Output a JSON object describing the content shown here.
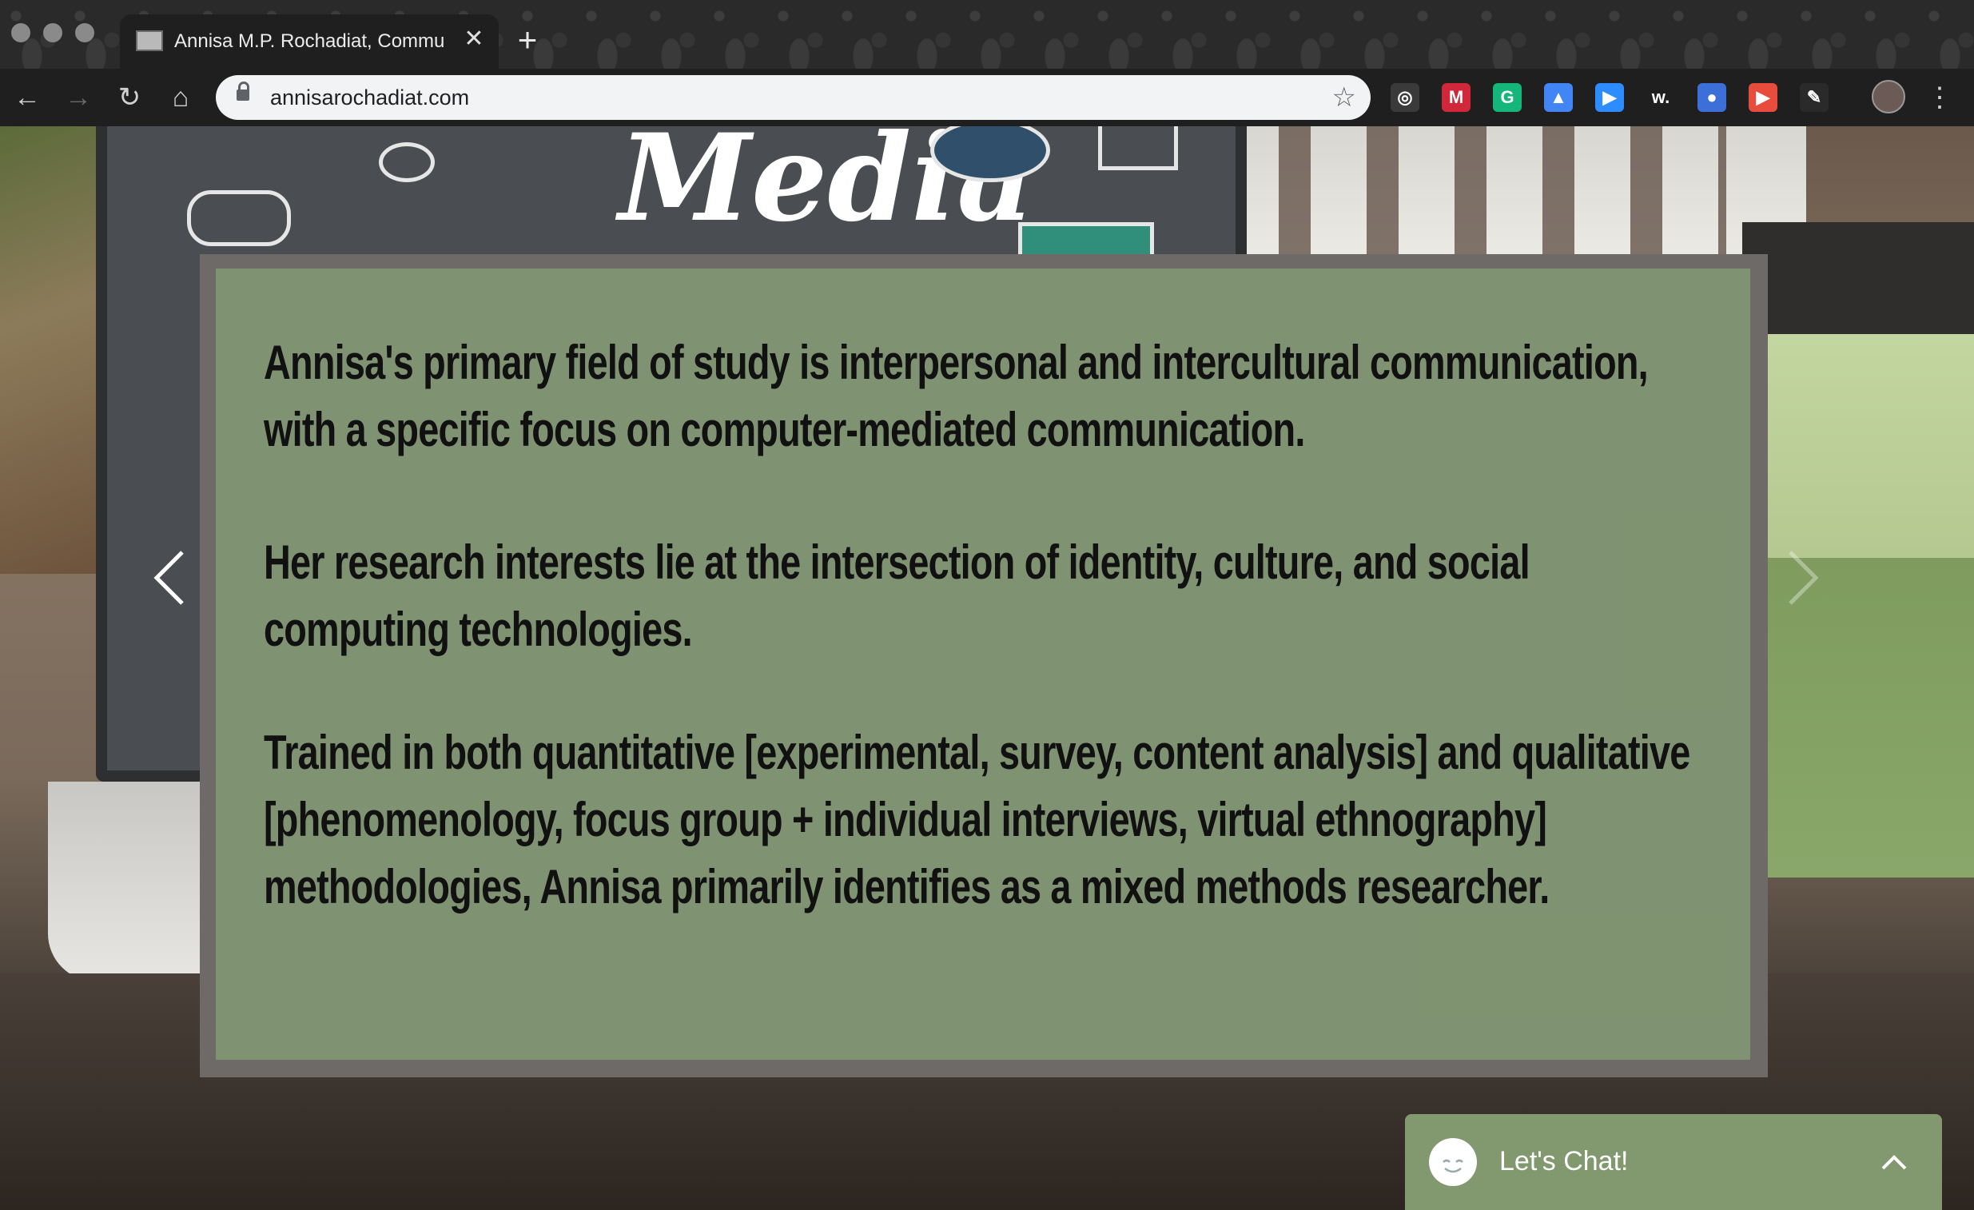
{
  "browser": {
    "tab_title": "Annisa M.P. Rochadiat, Commun",
    "tab_close": "✕",
    "new_tab": "+",
    "url": "annisarochadiat.com",
    "back_icon": "←",
    "forward_icon": "→",
    "reload_icon": "↻",
    "home_icon": "⌂",
    "bookmark_icon": "☆",
    "menu_icon": "⋮",
    "extensions": [
      {
        "name": "timer-extension-icon",
        "glyph": "◎",
        "color": "#3a3a3a"
      },
      {
        "name": "mendeley-extension-icon",
        "glyph": "M",
        "color": "#d0283a"
      },
      {
        "name": "grammarly-extension-icon",
        "glyph": "G",
        "color": "#15b67a"
      },
      {
        "name": "scholar-extension-icon",
        "glyph": "▲",
        "color": "#4285f4"
      },
      {
        "name": "zoom-extension-icon",
        "glyph": "▶",
        "color": "#2d8cff"
      },
      {
        "name": "wordtune-extension-icon",
        "glyph": "w.",
        "color": "#1f1f1f"
      },
      {
        "name": "rocket-extension-icon",
        "glyph": "●",
        "color": "#3d6fd8"
      },
      {
        "name": "video-extension-icon",
        "glyph": "▶",
        "color": "#e74c3c"
      },
      {
        "name": "pen-extension-icon",
        "glyph": "✎",
        "color": "#2a2a2a"
      }
    ]
  },
  "hero": {
    "media_text": "Media"
  },
  "card": {
    "paragraph1": "Annisa's primary field of study is interpersonal and intercultural communication, with a specific focus on computer-mediated communication.",
    "paragraph2": "Her research interests lie at the intersection of identity, culture, and social computing technologies.",
    "paragraph3": "Trained in both quantitative [experimental, survey, content analysis] and qualitative [phenomenology, focus group + individual interviews, virtual ethnography] methodologies, Annisa primarily identifies as a mixed methods researcher."
  },
  "chat": {
    "label": "Let's Chat!"
  }
}
